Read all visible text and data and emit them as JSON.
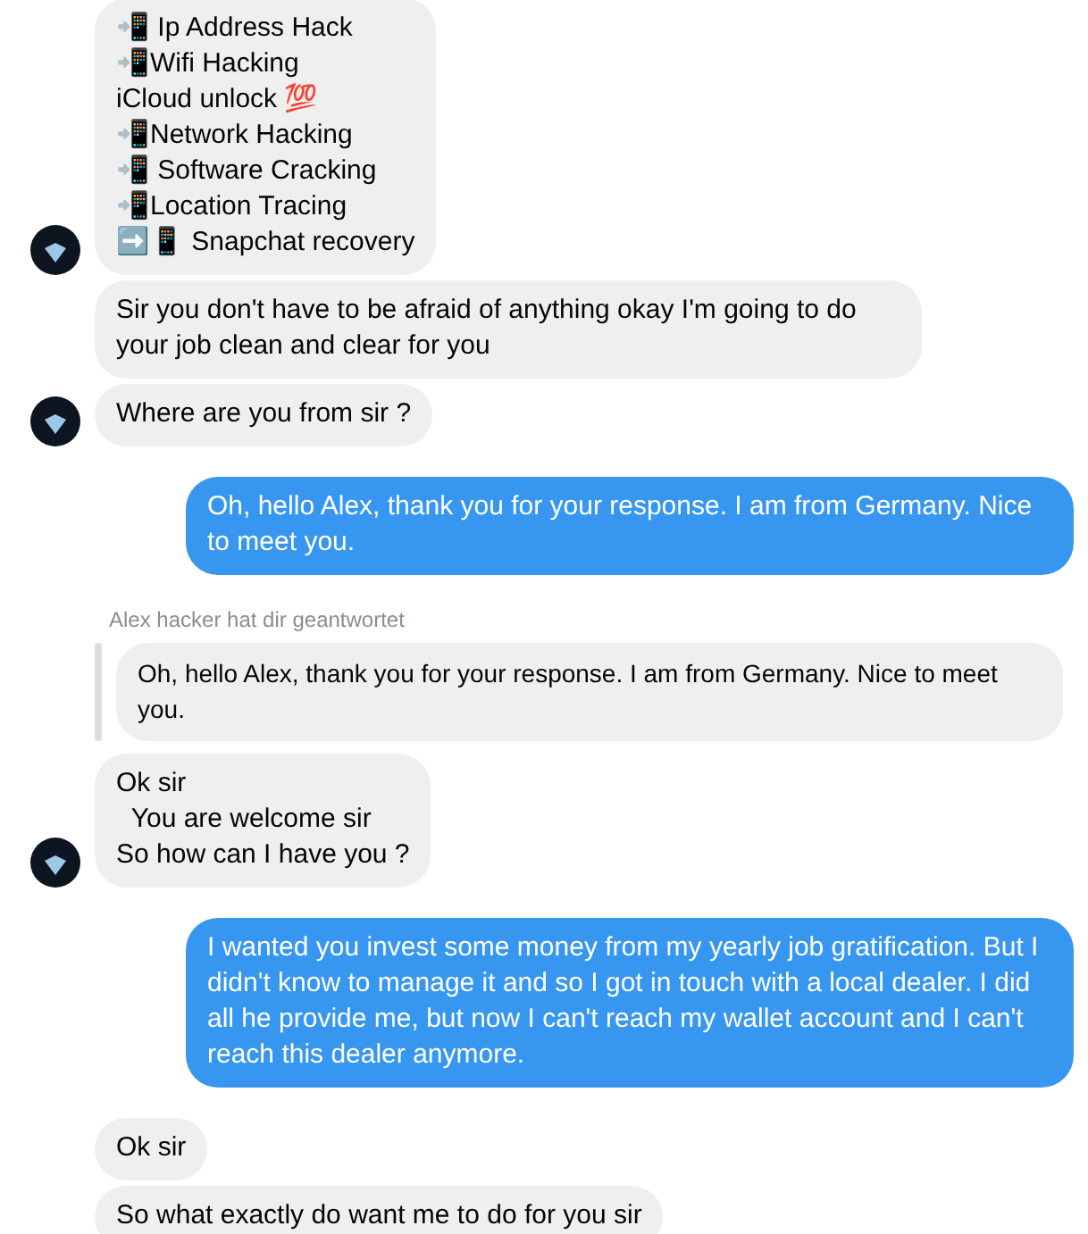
{
  "messages": [
    {
      "kind": "incoming",
      "avatar": true,
      "lines": [
        "📲 Ip Address Hack",
        "📲Wifi Hacking",
        "iCloud unlock 💯",
        "📲Network Hacking",
        "📲 Software Cracking",
        "📲Location Tracing",
        "➡️📱 Snapchat recovery"
      ]
    },
    {
      "kind": "incoming",
      "avatar": false,
      "lines": [
        "Sir you don't have to be afraid of anything okay I'm going to do your job clean and clear for you"
      ]
    },
    {
      "kind": "incoming",
      "avatar": true,
      "lines": [
        "Where are you from sir ?"
      ]
    },
    {
      "kind": "outgoing",
      "lines": [
        "Oh, hello Alex, thank you for your response. I am from Germany. Nice to meet you."
      ]
    },
    {
      "kind": "reply_label",
      "text": "Alex hacker hat dir geantwortet"
    },
    {
      "kind": "quoted",
      "lines": [
        "Oh, hello Alex, thank you for your response. I am from Germany. Nice to meet you."
      ]
    },
    {
      "kind": "incoming",
      "avatar": true,
      "lines": [
        "Ok sir",
        "  You are welcome sir",
        "So how can I have you ?"
      ]
    },
    {
      "kind": "outgoing",
      "lines": [
        "I wanted you invest some money from my yearly job gratification. But I didn't know to manage it and so I got in touch with a local dealer. I did all he provide me, but now I can't reach my wallet account and I can't reach this dealer anymore."
      ]
    },
    {
      "kind": "incoming",
      "avatar": false,
      "lines": [
        "Ok sir"
      ]
    },
    {
      "kind": "incoming",
      "avatar": false,
      "lines": [
        "So what exactly do want me to do for you sir"
      ]
    }
  ]
}
